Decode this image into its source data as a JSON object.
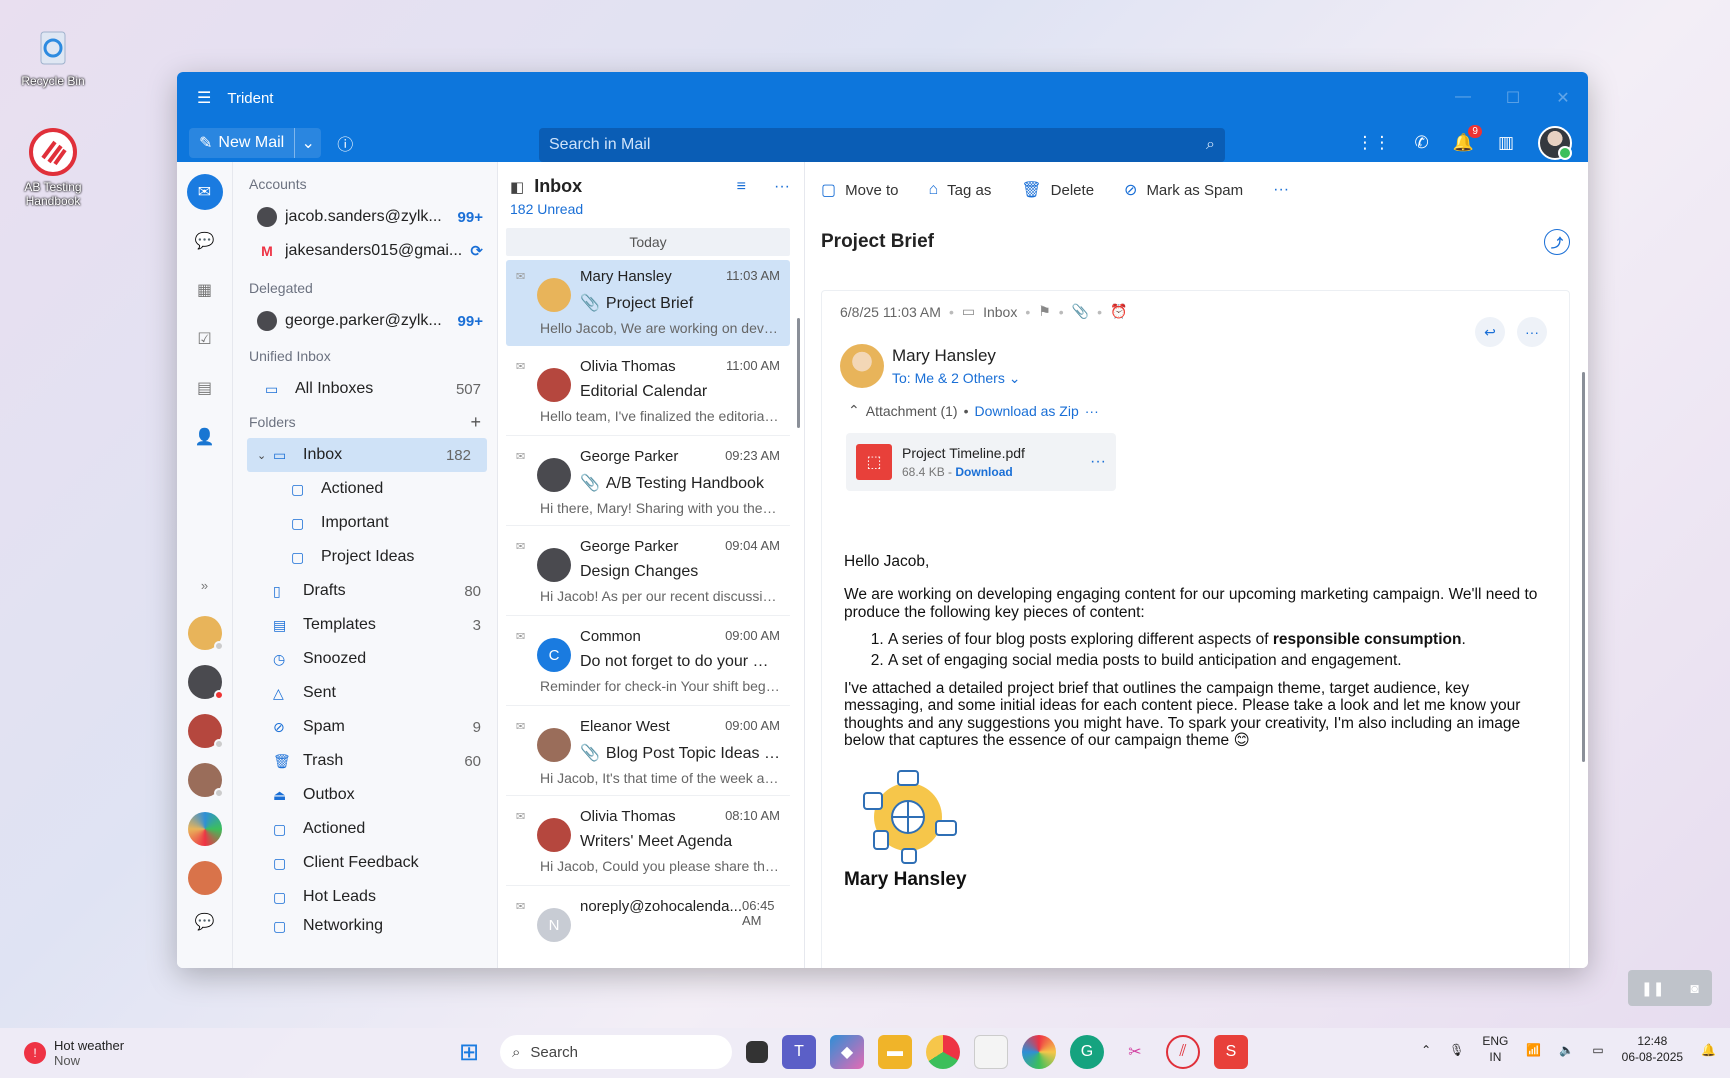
{
  "desktop": {
    "icons": [
      {
        "label": "Recycle Bin"
      },
      {
        "label": "AB Testing Handbook"
      }
    ]
  },
  "window": {
    "title": "Trident",
    "new_mail": "New Mail",
    "search_placeholder": "Search in Mail",
    "notification_count": "9"
  },
  "folders": {
    "accounts_header": "Accounts",
    "accounts": [
      {
        "email": "jacob.sanders@zylk...",
        "count": "99+"
      },
      {
        "email": "jakesanders015@gmai...",
        "count": ""
      }
    ],
    "delegated_header": "Delegated",
    "delegated": [
      {
        "email": "george.parker@zylk...",
        "count": "99+"
      }
    ],
    "unified_header": "Unified Inbox",
    "all_inboxes": {
      "label": "All Inboxes",
      "count": "507"
    },
    "folders_header": "Folders",
    "inbox": {
      "label": "Inbox",
      "count": "182"
    },
    "subfolders": [
      {
        "label": "Actioned"
      },
      {
        "label": "Important"
      },
      {
        "label": "Project Ideas"
      }
    ],
    "items": [
      {
        "label": "Drafts",
        "count": "80",
        "icon": "draft-icon"
      },
      {
        "label": "Templates",
        "count": "3",
        "icon": "template-icon"
      },
      {
        "label": "Snoozed",
        "count": "",
        "icon": "snooze-icon"
      },
      {
        "label": "Sent",
        "count": "",
        "icon": "sent-icon"
      },
      {
        "label": "Spam",
        "count": "9",
        "icon": "spam-icon"
      },
      {
        "label": "Trash",
        "count": "60",
        "icon": "trash-icon"
      },
      {
        "label": "Outbox",
        "count": "",
        "icon": "outbox-icon"
      },
      {
        "label": "Actioned",
        "count": "",
        "icon": "folder-icon"
      },
      {
        "label": "Client Feedback",
        "count": "",
        "icon": "folder-icon"
      },
      {
        "label": "Hot Leads",
        "count": "",
        "icon": "folder-icon"
      },
      {
        "label": "Networking",
        "count": "",
        "icon": "folder-icon"
      }
    ]
  },
  "list": {
    "title": "Inbox",
    "unread": "182 Unread",
    "group": "Today",
    "messages": [
      {
        "from": "Mary Hansley",
        "time": "11:03 AM",
        "subject": "Project Brief",
        "preview": "Hello Jacob, We are working on developin...",
        "attach": true,
        "avatar_color": "#e8b45a"
      },
      {
        "from": "Olivia Thomas",
        "time": "11:00 AM",
        "subject": "Editorial Calendar",
        "preview": "Hello team, I've finalized the editorial cale...",
        "attach": false,
        "avatar_color": "#b5473e"
      },
      {
        "from": "George Parker",
        "time": "09:23 AM",
        "subject": "A/B Testing Handbook",
        "preview": "Hi there, Mary! Sharing with you the requ...",
        "attach": true,
        "avatar_color": "#4a4a4f"
      },
      {
        "from": "George Parker",
        "time": "09:04 AM",
        "subject": "Design Changes",
        "preview": "Hi Jacob! As per our recent discussion, I a...",
        "attach": false,
        "avatar_color": "#4a4a4f"
      },
      {
        "from": "Common",
        "time": "09:00 AM",
        "subject": "Do not forget to do your Check...",
        "preview": "Reminder for check-in Your shift begins at...",
        "attach": false,
        "avatar_color": "#1a7be0",
        "initial": "C"
      },
      {
        "from": "Eleanor West",
        "time": "09:00 AM",
        "subject": "Blog Post Topic Ideas for Thi...",
        "preview": "Hi Jacob, It's that time of the week again...",
        "attach": true,
        "avatar_color": "#9a6d5a"
      },
      {
        "from": "Olivia Thomas",
        "time": "08:10 AM",
        "subject": "Writers' Meet Agenda",
        "preview": "Hi Jacob, Could you please share the agen...",
        "attach": false,
        "avatar_color": "#b5473e"
      },
      {
        "from": "noreply@zohocalenda...",
        "time": "06:45 AM",
        "subject": "",
        "preview": "",
        "attach": false,
        "avatar_color": "#c8ccd4",
        "initial": "N"
      }
    ]
  },
  "reader": {
    "toolbar": {
      "move": "Move to",
      "tag": "Tag as",
      "delete": "Delete",
      "spam": "Mark as Spam"
    },
    "subject": "Project Brief",
    "date": "6/8/25 11:03 AM",
    "folder": "Inbox",
    "sender": "Mary Hansley",
    "to": "To: Me & 2 Others",
    "attachment_header": "Attachment (1)",
    "download_zip": "Download as Zip",
    "file_name": "Project Timeline.pdf",
    "file_size": "68.4 KB - ",
    "file_download": "Download",
    "greeting": "Hello Jacob,",
    "para1": "We are working on developing engaging content for our upcoming marketing campaign. We'll need to produce the following key pieces of content:",
    "item1_a": "A series of four blog posts exploring different aspects of ",
    "item1_b": "responsible consumption",
    "item1_c": ".",
    "item2": "A set of engaging social media posts to build anticipation and engagement.",
    "para2": "I've attached a detailed project brief that outlines the campaign theme, target audience, key messaging, and some initial ideas for each content piece. Please take a look and let me know your thoughts and any suggestions you might have. To spark your creativity, I'm also including an image below that captures the essence of our campaign theme 😊",
    "signature": "Mary Hansley"
  },
  "taskbar": {
    "weather": "Hot weather",
    "weather_sub": "Now",
    "search": "Search",
    "lang1": "ENG",
    "lang2": "IN",
    "time": "12:48",
    "date": "06-08-2025"
  }
}
